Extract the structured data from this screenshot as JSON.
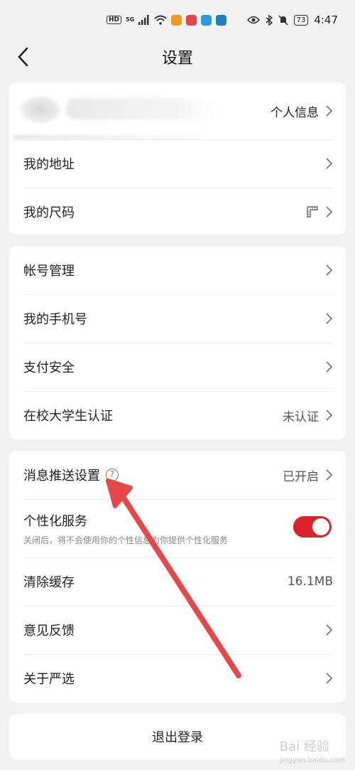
{
  "status_bar": {
    "hd": "HD",
    "network": "5G",
    "battery": "73",
    "time": "4:47"
  },
  "header": {
    "title": "设置"
  },
  "profile": {
    "personal_info_label": "个人信息"
  },
  "group1": {
    "items": [
      {
        "label": "我的地址"
      },
      {
        "label": "我的尺码"
      }
    ]
  },
  "group2": {
    "items": [
      {
        "label": "帐号管理"
      },
      {
        "label": "我的手机号"
      },
      {
        "label": "支付安全"
      },
      {
        "label": "在校大学生认证",
        "value": "未认证"
      }
    ]
  },
  "group3": {
    "push": {
      "label": "消息推送设置",
      "value": "已开启",
      "help": "?"
    },
    "personalized": {
      "label": "个性化服务",
      "desc": "关闭后，将不会使用你的个性信息为你提供个性化服务",
      "enabled": true
    },
    "clear_cache": {
      "label": "清除缓存",
      "value": "16.1MB"
    },
    "feedback": {
      "label": "意见反馈"
    },
    "about": {
      "label": "关于严选"
    }
  },
  "logout": {
    "label": "退出登录"
  },
  "watermark": {
    "text": "Bai 经验",
    "url": "jingyan.baidu.com"
  },
  "colors": {
    "accent_red": "#d9222a",
    "background": "#f2f2f2",
    "arrow": "#e8474a"
  }
}
